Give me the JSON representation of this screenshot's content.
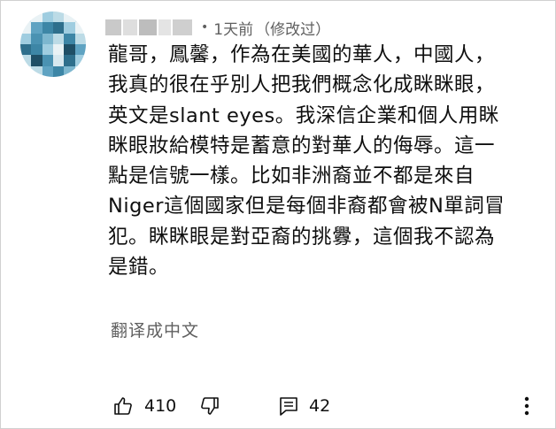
{
  "comment": {
    "time": "1天前",
    "edited": "（修改过）",
    "body": "龍哥，鳳馨，作為在美國的華人，中國人，\n我真的很在乎別人把我們概念化成眯眯眼，\n英文是slant eyes。我深信企業和個人用眯\n眯眼妝給模特是蓄意的對華人的侮辱。這一\n點是信號一樣。比如非洲裔並不都是來自\nNiger這個國家但是每個非裔都會被N單詞冒\n犯。眯眯眼是對亞裔的挑釁，這個我不認為\n是錯。",
    "translate_label": "翻译成中文",
    "likes": "410",
    "replies": "42",
    "separator": "•"
  },
  "icons": {
    "like": "thumbs-up-icon",
    "dislike": "thumbs-down-icon",
    "reply": "reply-comment-icon",
    "more": "more-vertical-icon"
  }
}
